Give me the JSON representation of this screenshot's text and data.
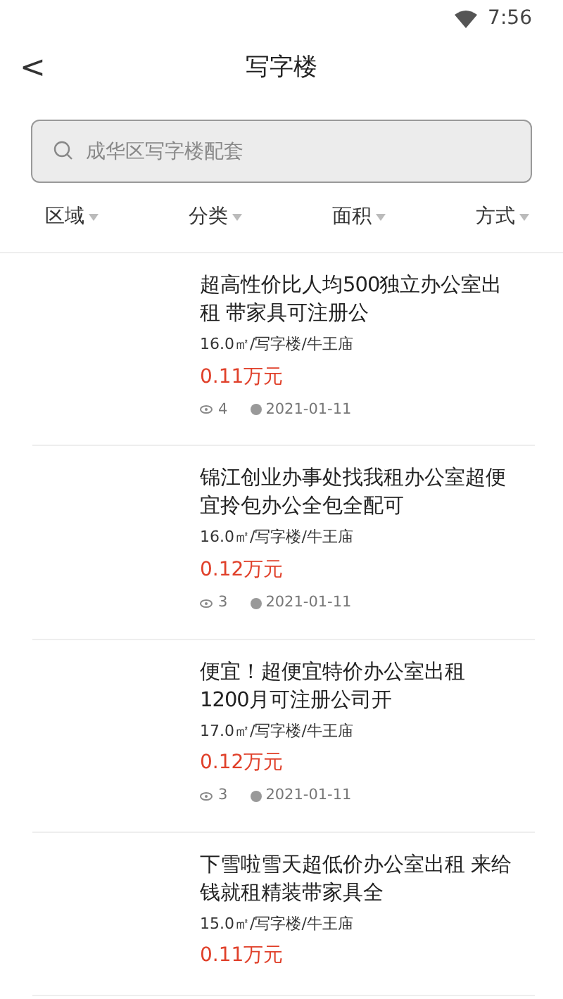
{
  "status_bar": {
    "time": "7:56"
  },
  "header": {
    "back": "<",
    "title": "写字楼"
  },
  "search": {
    "placeholder": "成华区写字楼配套"
  },
  "filters": [
    {
      "label": "区域"
    },
    {
      "label": "分类"
    },
    {
      "label": "面积"
    },
    {
      "label": "方式"
    }
  ],
  "listings": [
    {
      "title": "超高性价比人均500独立办公室出租 带家具可注册公",
      "details": "16.0㎡/写字楼/牛王庙",
      "price": "0.11万元",
      "views": "4",
      "date": "2021-01-11"
    },
    {
      "title": "锦江创业办事处找我租办公室超便宜拎包办公全包全配可",
      "details": "16.0㎡/写字楼/牛王庙",
      "price": "0.12万元",
      "views": "3",
      "date": "2021-01-11"
    },
    {
      "title": "便宜！超便宜特价办公室出租 1200月可注册公司开",
      "details": "17.0㎡/写字楼/牛王庙",
      "price": "0.12万元",
      "views": "3",
      "date": "2021-01-11"
    },
    {
      "title": "下雪啦雪天超低价办公室出租 来给钱就租精装带家具全",
      "details": "15.0㎡/写字楼/牛王庙",
      "price": "0.11万元"
    }
  ]
}
